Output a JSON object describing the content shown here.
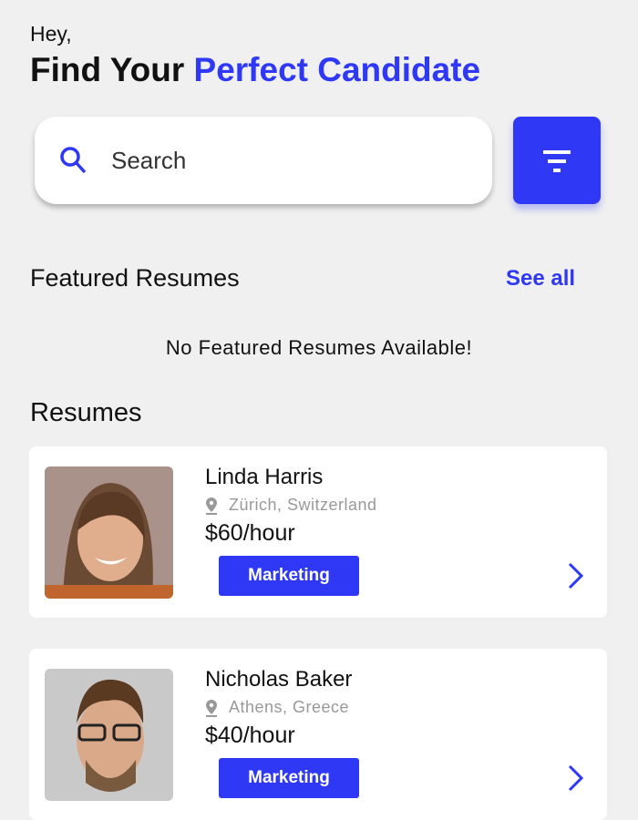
{
  "header": {
    "greeting": "Hey,",
    "title_prefix": "Find Your ",
    "title_accent": "Perfect Candidate"
  },
  "search": {
    "placeholder": "Search",
    "value": ""
  },
  "featured": {
    "heading": "Featured Resumes",
    "see_all": "See all",
    "empty_message": "No Featured Resumes Available!"
  },
  "resumes": {
    "heading": "Resumes",
    "items": [
      {
        "name": "Linda Harris",
        "location": "Zürich, Switzerland",
        "rate": "$60/hour",
        "category": "Marketing"
      },
      {
        "name": "Nicholas Baker",
        "location": "Athens, Greece",
        "rate": "$40/hour",
        "category": "Marketing"
      }
    ]
  },
  "colors": {
    "accent": "#2e38f5",
    "background": "#f0f0f0"
  }
}
